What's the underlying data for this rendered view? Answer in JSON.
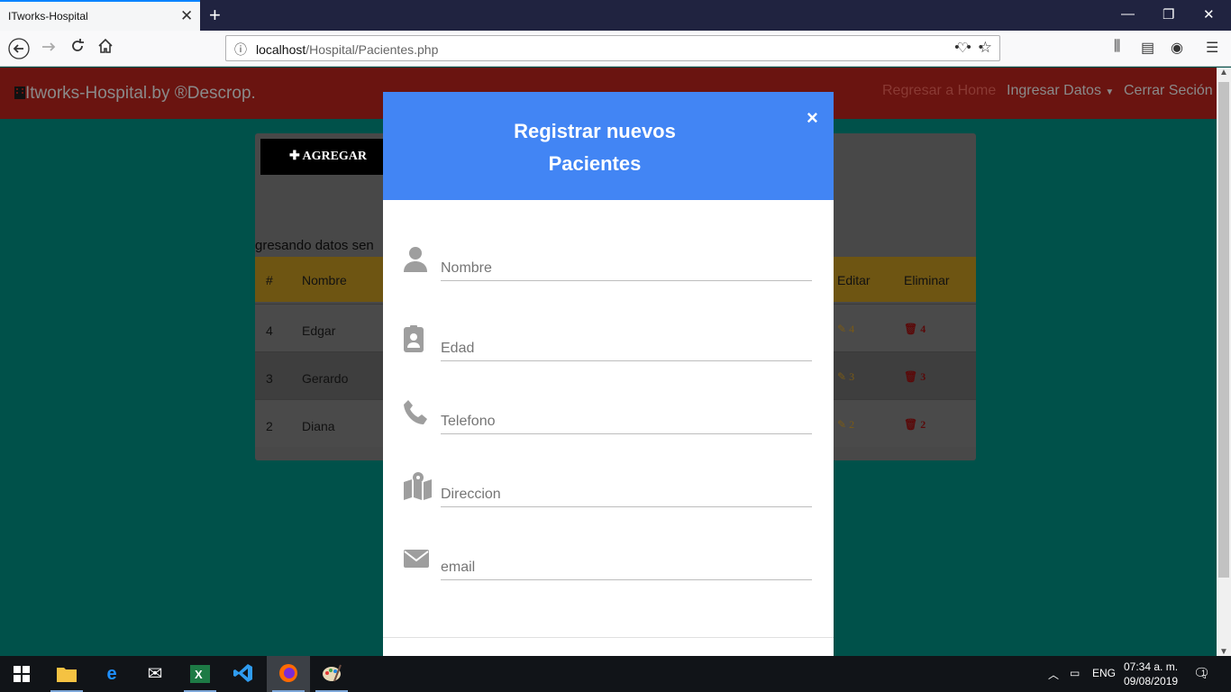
{
  "browser": {
    "tab_title": "ITworks-Hospital",
    "tab_close": "✕",
    "new_tab": "+",
    "url_host": "localhost",
    "url_path": "/Hospital/Pacientes.php",
    "url_actions": "•••",
    "window_controls": [
      "—",
      "❐",
      "✕"
    ]
  },
  "app": {
    "brand": "Itworks-Hospital.by ®Descrop.",
    "menu": {
      "home": "Regresar a Home",
      "ingresar": "Ingresar Datos",
      "cerrar": "Cerrar Seción"
    }
  },
  "card": {
    "add_button": "AGREGAR",
    "partial_text": "gresando datos sen",
    "headers": {
      "num": "#",
      "nombre": "Nombre",
      "editar": "Editar",
      "eliminar": "Eliminar"
    },
    "rows": [
      {
        "id": "4",
        "nombre": "Edgar"
      },
      {
        "id": "3",
        "nombre": "Gerardo"
      },
      {
        "id": "2",
        "nombre": "Diana"
      }
    ]
  },
  "modal": {
    "title_line1": "Registrar nuevos",
    "title_line2": "Pacientes",
    "close": "×",
    "fields": {
      "nombre": "Nombre",
      "edad": "Edad",
      "telefono": "Telefono",
      "direccion": "Direccion",
      "email": "email"
    }
  },
  "taskbar": {
    "lang": "ENG",
    "time": "07:34 a. m.",
    "date": "09/08/2019",
    "notifications": "1"
  },
  "colors": {
    "modal_header": "#4285f4",
    "page_bg": "#00514a",
    "app_header": "#6a1410",
    "table_header": "#6e5512"
  }
}
